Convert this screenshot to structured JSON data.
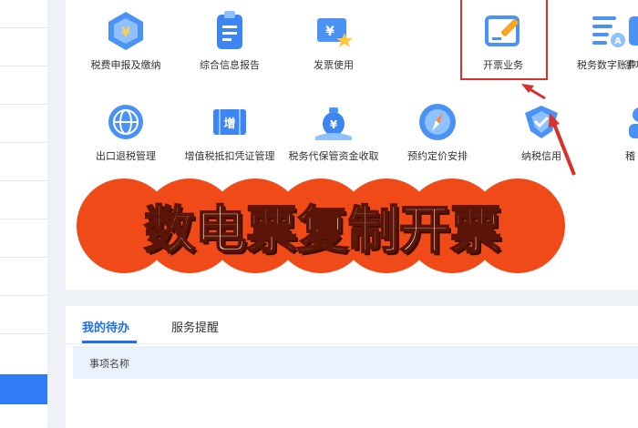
{
  "services": {
    "row1": [
      {
        "label": "税费申报及缴纳",
        "icon": "tax-declaration-icon"
      },
      {
        "label": "综合信息报告",
        "icon": "report-document-icon"
      },
      {
        "label": "发票使用",
        "icon": "invoice-star-icon"
      },
      {
        "label": "开票业务",
        "icon": "invoice-edit-icon"
      },
      {
        "label": "税务数字账户",
        "icon": "digital-account-icon"
      },
      {
        "label": "事项",
        "icon": "partial-icon"
      }
    ],
    "row2": [
      {
        "label": "出口退税管理",
        "icon": "globe-icon"
      },
      {
        "label": "增值税抵扣凭证管理",
        "icon": "vat-ticket-icon"
      },
      {
        "label": "税务代保管资金收取",
        "icon": "money-bag-icon"
      },
      {
        "label": "预约定价安排",
        "icon": "compass-icon"
      },
      {
        "label": "纳税信用",
        "icon": "shield-check-icon"
      },
      {
        "label": "稽",
        "icon": "partial-user-icon"
      }
    ]
  },
  "banner": {
    "text": "数电票复制开票",
    "color": "#f04a18"
  },
  "todo": {
    "tabs": [
      {
        "label": "我的待办",
        "active": true
      },
      {
        "label": "服务提醒",
        "active": false
      }
    ],
    "header": "事项名称"
  },
  "colors": {
    "accent": "#2f7cf6",
    "highlight": "#d9302a"
  }
}
